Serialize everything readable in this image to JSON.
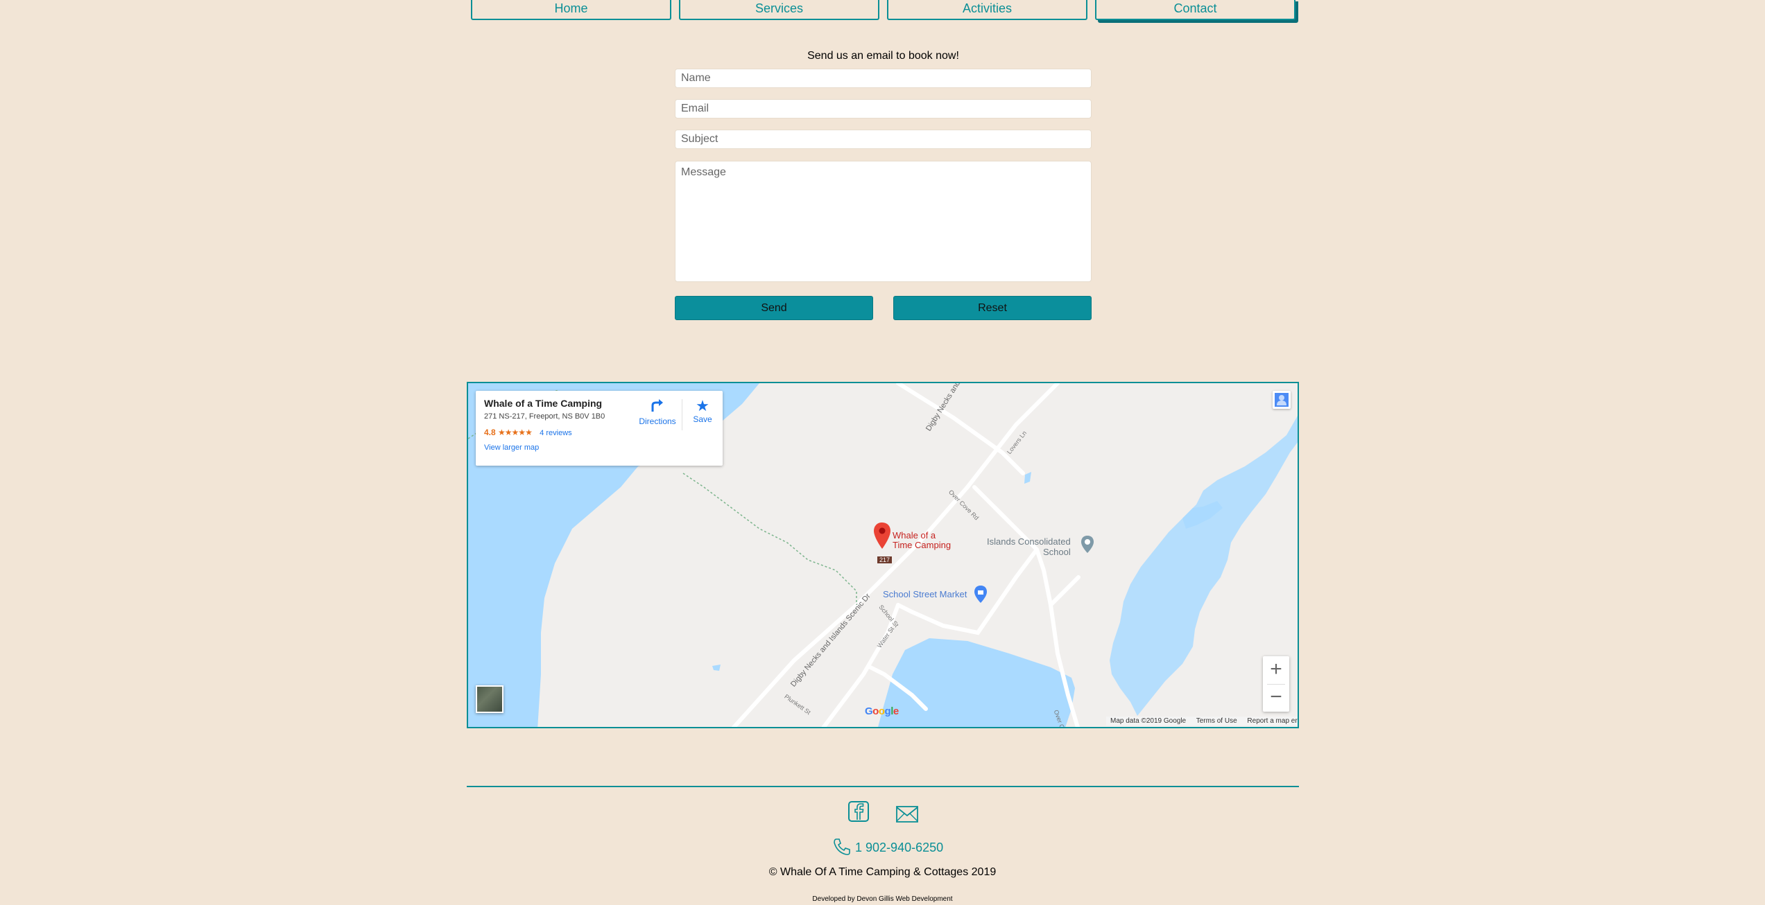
{
  "nav": {
    "tabs": [
      {
        "label": "Home"
      },
      {
        "label": "Services"
      },
      {
        "label": "Activities"
      },
      {
        "label": "Contact"
      }
    ]
  },
  "contact_form": {
    "intro": "Send us an email to book now!",
    "name_placeholder": "Name",
    "email_placeholder": "Email",
    "subject_placeholder": "Subject",
    "message_placeholder": "Message",
    "send_label": "Send",
    "reset_label": "Reset"
  },
  "map": {
    "place_name": "Whale of a Time Camping",
    "address": "271 NS-217, Freeport, NS B0V 1B0",
    "rating": "4.8",
    "stars": "★★★★★",
    "reviews": "4 reviews",
    "view_larger": "View larger map",
    "directions_label": "Directions",
    "save_label": "Save",
    "pin_label_line1": "Whale of a",
    "pin_label_line2": "Time Camping",
    "highway_shield": "217",
    "poi_school_line1": "Islands Consolidated",
    "poi_school_line2": "School",
    "poi_market": "School Street Market",
    "road_scenic_1": "Digby Necks and Islands Scenic Dr",
    "road_scenic_2": "Digby Necks and Islands Scenic Dr",
    "road_lovers": "Lovers Ln",
    "road_overcove": "Over Cove Rd",
    "road_school": "School St",
    "road_water": "Water St",
    "road_plunkett": "Plunkett St",
    "road_overcove_2": "Over C",
    "google_logo": "Google",
    "map_data": "Map data ©2019 Google",
    "terms": "Terms of Use",
    "report": "Report a map error",
    "zoom_in": "+",
    "zoom_out": "−",
    "colors": {
      "water": "#aadaff",
      "land": "#f1efed",
      "pin": "#ea4335",
      "poi": "#4285f4"
    }
  },
  "footer": {
    "facebook_icon": "facebook-icon",
    "email_icon": "envelope-icon",
    "phone": "1 902-940-6250",
    "copyright": "© Whale Of A Time Camping & Cottages 2019",
    "developer": "Developed by Devon Gillis Web Development",
    "accent_color": "#0b8f96"
  }
}
